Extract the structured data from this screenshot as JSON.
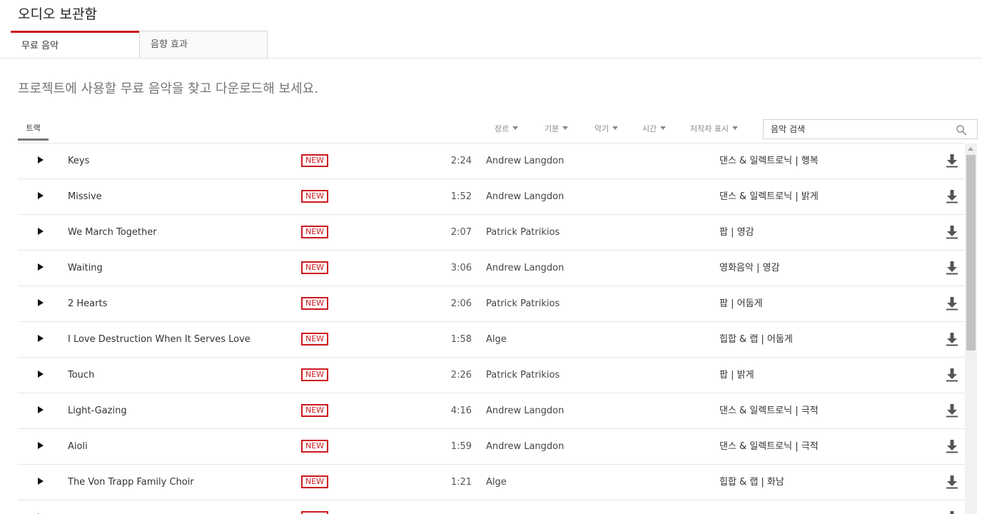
{
  "page": {
    "title": "오디오 보관함"
  },
  "tabs": [
    {
      "label": "무료 음악",
      "active": true
    },
    {
      "label": "음향 효과",
      "active": false
    }
  ],
  "intro": "프로젝트에 사용할 무료 음악을 찾고 다운로드해 보세요.",
  "toolbar": {
    "track_tab": "트랙",
    "filters": [
      "장르",
      "기분",
      "악기",
      "시간",
      "저작자 표시"
    ],
    "search_placeholder": "음악 검색"
  },
  "badge_label": "NEW",
  "colors": {
    "accent": "#cc181e",
    "text": "#333333",
    "muted": "#767676"
  },
  "tracks": [
    {
      "title": "Keys",
      "duration": "2:24",
      "artist": "Andrew Langdon",
      "genre": "댄스 & 일렉트로닉 | 행복"
    },
    {
      "title": "Missive",
      "duration": "1:52",
      "artist": "Andrew Langdon",
      "genre": "댄스 & 일렉트로닉 | 밝게"
    },
    {
      "title": "We March Together",
      "duration": "2:07",
      "artist": "Patrick Patrikios",
      "genre": "팝 | 영감"
    },
    {
      "title": "Waiting",
      "duration": "3:06",
      "artist": "Andrew Langdon",
      "genre": "영화음악 | 영감"
    },
    {
      "title": "2 Hearts",
      "duration": "2:06",
      "artist": "Patrick Patrikios",
      "genre": "팝 | 어둡게"
    },
    {
      "title": "I Love Destruction When It Serves Love",
      "duration": "1:58",
      "artist": "Alge",
      "genre": "힙합 & 랩 | 어둡게"
    },
    {
      "title": "Touch",
      "duration": "2:26",
      "artist": "Patrick Patrikios",
      "genre": "팝 | 밝게"
    },
    {
      "title": "Light-Gazing",
      "duration": "4:16",
      "artist": "Andrew Langdon",
      "genre": "댄스 & 일렉트로닉 | 극적"
    },
    {
      "title": "Aioli",
      "duration": "1:59",
      "artist": "Andrew Langdon",
      "genre": "댄스 & 일렉트로닉 | 극적"
    },
    {
      "title": "The Von Trapp Family Choir",
      "duration": "1:21",
      "artist": "Alge",
      "genre": "힙합 & 랩 | 화남"
    }
  ]
}
